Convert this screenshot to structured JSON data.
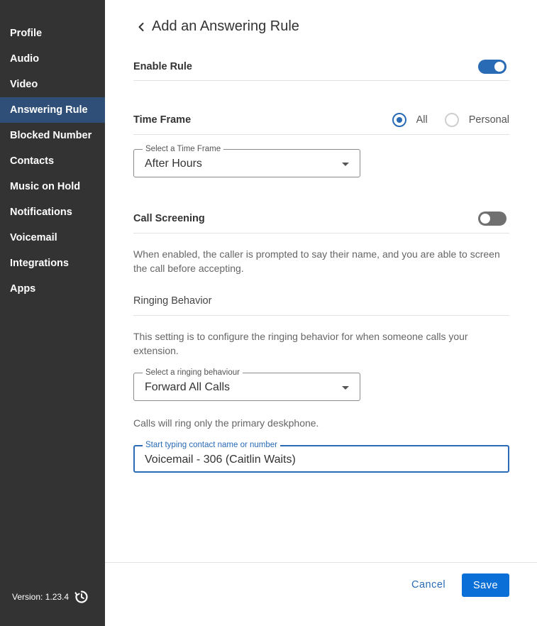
{
  "sidebar": {
    "items": [
      {
        "label": "Profile",
        "active": false
      },
      {
        "label": "Audio",
        "active": false
      },
      {
        "label": "Video",
        "active": false
      },
      {
        "label": "Answering Rule",
        "active": true
      },
      {
        "label": "Blocked Number",
        "active": false
      },
      {
        "label": "Contacts",
        "active": false
      },
      {
        "label": "Music on Hold",
        "active": false
      },
      {
        "label": "Notifications",
        "active": false
      },
      {
        "label": "Voicemail",
        "active": false
      },
      {
        "label": "Integrations",
        "active": false
      },
      {
        "label": "Apps",
        "active": false
      }
    ],
    "version": "Version: 1.23.4",
    "version_icon": "refresh-icon"
  },
  "header": {
    "back_icon": "chevron-left-icon",
    "title": "Add an Answering Rule"
  },
  "enable_rule": {
    "label": "Enable Rule",
    "enabled": true
  },
  "time_frame": {
    "label": "Time Frame",
    "options": [
      {
        "label": "All",
        "checked": true
      },
      {
        "label": "Personal",
        "checked": false
      }
    ],
    "select_legend": "Select a Time Frame",
    "select_value": "After Hours"
  },
  "call_screening": {
    "label": "Call Screening",
    "enabled": false,
    "help": "When enabled, the caller is prompted to say their name, and you are able to screen the call before accepting."
  },
  "ringing_behavior": {
    "label": "Ringing Behavior",
    "help": "This setting is to configure the ringing behavior for when someone calls your extension.",
    "select_legend": "Select a ringing behaviour",
    "select_value": "Forward All Calls",
    "note": "Calls will ring only the primary deskphone."
  },
  "forward_target": {
    "legend": "Start typing contact name or number",
    "value": "Voicemail - 306 (Caitlin Waits)"
  },
  "footer": {
    "cancel_label": "Cancel",
    "save_label": "Save"
  },
  "colors": {
    "sidebar_bg": "#333333",
    "sidebar_active": "#2f4f78",
    "accent": "#2a6bb5",
    "save_button": "#0a6fd6"
  }
}
